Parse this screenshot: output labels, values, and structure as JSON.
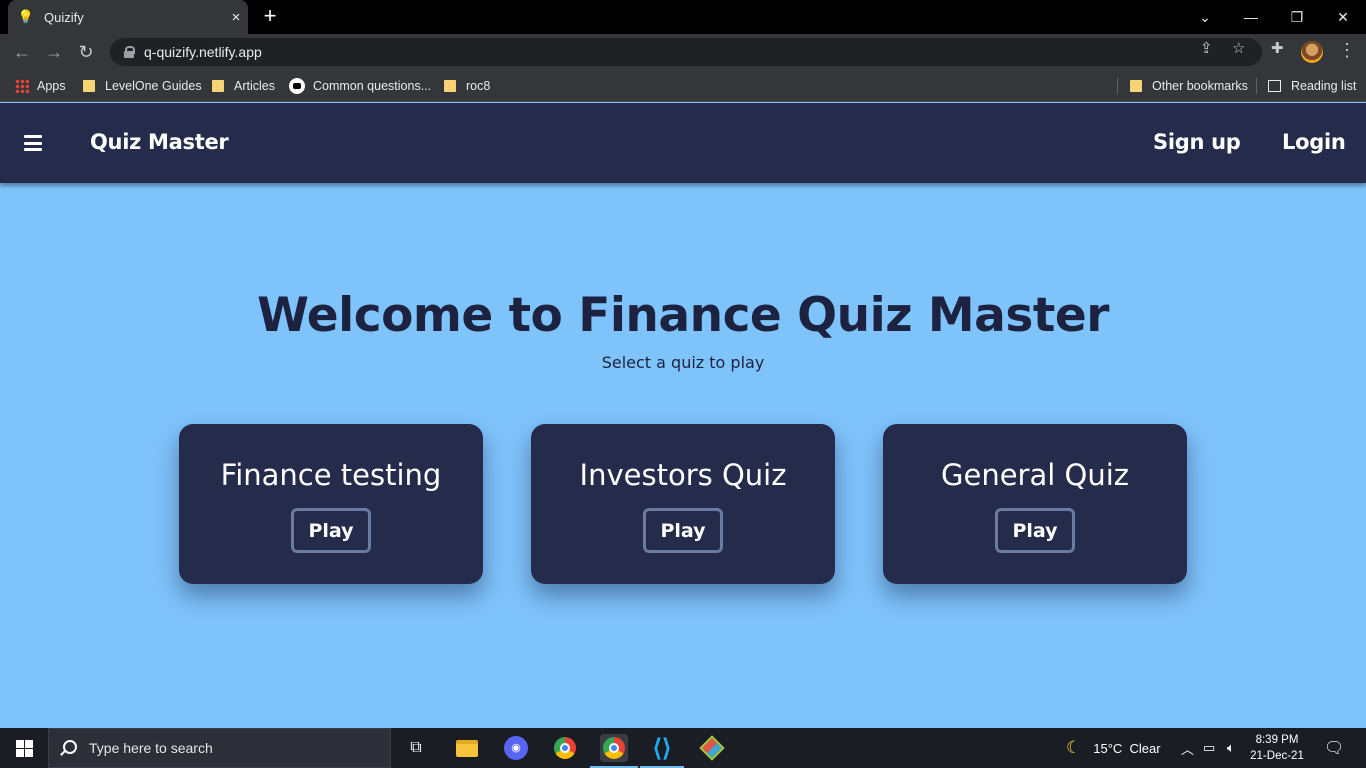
{
  "browser": {
    "tab_title": "Quizify",
    "new_tab_symbol": "+",
    "tab_close_symbol": "×",
    "window_controls": {
      "dropdown": "⌄",
      "minimize": "—",
      "restore": "❐",
      "close": "✕"
    },
    "nav": {
      "back": "←",
      "forward": "→",
      "reload": "↻"
    },
    "url": "q-quizify.netlify.app",
    "bookmarks": [
      {
        "label": "Apps",
        "icon": "apps-grid-icon"
      },
      {
        "label": "LevelOne Guides",
        "icon": "folder-icon"
      },
      {
        "label": "Articles",
        "icon": "folder-icon"
      },
      {
        "label": "Common questions...",
        "icon": "site-favicon-icon"
      },
      {
        "label": "roc8",
        "icon": "folder-icon"
      }
    ],
    "other_bookmarks": "Other bookmarks",
    "reading_list": "Reading list"
  },
  "app": {
    "brand": "Quiz Master",
    "nav_links": {
      "signup": "Sign up",
      "login": "Login"
    },
    "hero_title": "Welcome to Finance Quiz Master",
    "hero_subtitle": "Select a quiz to play",
    "quizzes": [
      {
        "title": "Finance testing",
        "button": "Play"
      },
      {
        "title": "Investors Quiz",
        "button": "Play"
      },
      {
        "title": "General Quiz",
        "button": "Play"
      }
    ],
    "colors": {
      "background": "#7fc3fb",
      "navbar": "#252b4b",
      "card": "#252b4b",
      "title_text": "#1c2240"
    }
  },
  "taskbar": {
    "search_placeholder": "Type here to search",
    "weather": "15°C  Clear",
    "time": "8:39 PM",
    "date": "21-Dec-21"
  }
}
